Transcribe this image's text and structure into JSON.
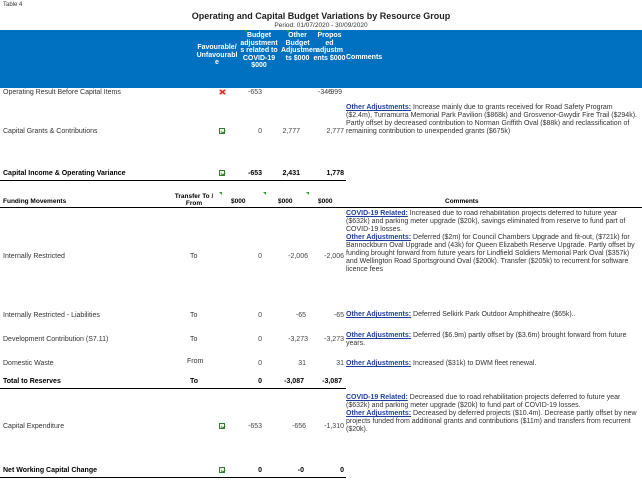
{
  "table_label": "Table 4",
  "title": "Operating and Capital Budget Variations by Resource Group",
  "period": "Period: 01/07/2020 - 30/09/2020",
  "header": {
    "fav": "Favourable/ Unfavourabl e",
    "budget_adj": "Budget adjustment s related to COVID-19 $000",
    "other_adj": "Other Budget Adjustmen ts $000",
    "proposed_adj": "Propos ed adjustm ents $000",
    "comments": "Comments"
  },
  "rows": {
    "op_result": {
      "label": "Operating Result Before Capital Items",
      "covid": "-653",
      "other": "-346",
      "proposed": "-999"
    },
    "cap_grants": {
      "label": "Capital Grants & Contributions",
      "covid": "0",
      "other": "2,777",
      "proposed": "2,777",
      "c_label": "Other Adjustments:",
      "c_text": " Increase mainly due to grants received for Road Safety Program ($2.4m), Turramurra Memorial Park Pavilion ($868k) and Grosvenor-Gwydir Fire Trail ($294k). Partly offset by decreased contribution to Norman Griffith Oval ($88k) and reclassification of remaining contribution to unexpended grants ($675k)"
    },
    "cap_income": {
      "label": "Capital Income & Operating Variance",
      "covid": "-653",
      "other": "2,431",
      "proposed": "1,778"
    }
  },
  "funding_header": {
    "label": "Funding Movements",
    "transfer": "Transfer To / From",
    "c1": "$000",
    "c2": "$000",
    "c3": "$000",
    "comments": "Comments"
  },
  "funding": {
    "internally": {
      "label": "Internally Restricted",
      "dir": "To",
      "covid": "0",
      "other": "-2,006",
      "proposed": "-2,006",
      "c1_label": "COVID-19 Related:",
      "c1_text": " Increased due to road rehabilitation projects deferred to future year ($632k) and parking meter upgrade ($20k), savings eliminated from reserve to fund part of COVID-19 losses.",
      "c2_label": "Other Adjustments:",
      "c2_text": " Deferred ($2m) for Council Chambers Upgrade and fit-out, ($721k) for Bannockburn Oval Upgrade and (43k) for Queen Elizabeth Reserve Upgrade. Partly offset by funding brought forward from future years for Lindfield Soldiers Memorial Park Oval ($357k) and Wellington Road Sportsground Oval ($200k). Transfer ($205k) to recurrent for software licence fees"
    },
    "liabilities": {
      "label": "Internally Restricted - Liabilities",
      "dir": "To",
      "covid": "0",
      "other": "-65",
      "proposed": "-65",
      "c_label": "Other Adjustments:",
      "c_text": " Deferred Selkirk Park Outdoor Amphitheatre ($65k).."
    },
    "dev_contrib": {
      "label": "Development Contribution (S7.11)",
      "dir": "To",
      "covid": "0",
      "other": "-3,273",
      "proposed": "-3,273",
      "c_label": "Other Adjustments:",
      "c_text": " Deferred ($6.9m) partly offset by ($3.6m) brought forward from future years."
    },
    "domestic": {
      "label": "Domestic Waste",
      "dir": "From",
      "covid": "0",
      "other": "31",
      "proposed": "31",
      "c_label": "Other Adjustments:",
      "c_text": " Increased ($31k) to DWM fleet renewal."
    },
    "total": {
      "label": "Total to Reserves",
      "dir": "To",
      "covid": "0",
      "other": "-3,087",
      "proposed": "-3,087"
    },
    "capex": {
      "label": "Capital Expenditure",
      "covid": "-653",
      "other": "-656",
      "proposed": "-1,310",
      "c1_label": "COVID-19 Related:",
      "c1_text": " Decreased due to road rehabilitation projects deferred to future year ($632k) and parking meter upgrade ($20k) to fund part of COVID-19 losses.",
      "c2_label": "Other Adjustments:",
      "c2_text": " Decreased by deferred projects ($10.4m). Decrease partly offset by new projects funded from additional grants and contributions ($11m) and transfers from recurrent ($20k)."
    },
    "net": {
      "label": "Net Working Capital Change",
      "covid": "0",
      "other": "-0",
      "proposed": "0"
    }
  },
  "colors": {
    "header_bg": "#0070c0",
    "comment_label": "#1f3fa0",
    "fav_green": "#2e7d32",
    "unfav_red": "#d32f2f"
  },
  "icons": {
    "favourable": "green-check-icon",
    "unfavourable": "red-x-icon"
  }
}
